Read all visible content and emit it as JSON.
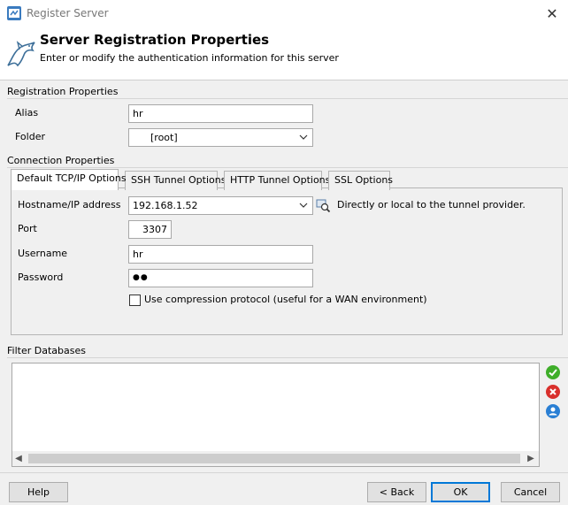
{
  "window": {
    "title": "Register Server",
    "close_glyph": "✕"
  },
  "header": {
    "title": "Server Registration Properties",
    "subtitle": "Enter or modify the authentication information for this server"
  },
  "registration": {
    "section_label": "Registration Properties",
    "alias_label": "Alias",
    "alias_value": "hr",
    "folder_label": "Folder",
    "folder_value": "[root]"
  },
  "connection": {
    "section_label": "Connection Properties",
    "tabs": [
      {
        "label": "Default TCP/IP Options",
        "active": true
      },
      {
        "label": "SSH Tunnel Options",
        "active": false
      },
      {
        "label": "HTTP Tunnel Options",
        "active": false
      },
      {
        "label": "SSL Options",
        "active": false
      }
    ],
    "hostname_label": "Hostname/IP address",
    "hostname_value": "192.168.1.52",
    "hostname_hint": "Directly or local to the tunnel provider.",
    "port_label": "Port",
    "port_value": "3307",
    "username_label": "Username",
    "username_value": "hr",
    "password_label": "Password",
    "password_value": "●●",
    "compression_label": "Use compression protocol (useful for a WAN environment)",
    "compression_checked": false
  },
  "filter": {
    "section_label": "Filter Databases",
    "items": [],
    "side_icons": [
      "check-icon",
      "remove-icon",
      "user-icon"
    ]
  },
  "buttons": {
    "help": "Help",
    "back": "< Back",
    "ok": "OK",
    "cancel": "Cancel"
  },
  "colors": {
    "accent": "#0078d7",
    "check_green": "#3fae2a",
    "remove_red": "#d9302c",
    "user_blue": "#2a7fd4"
  }
}
